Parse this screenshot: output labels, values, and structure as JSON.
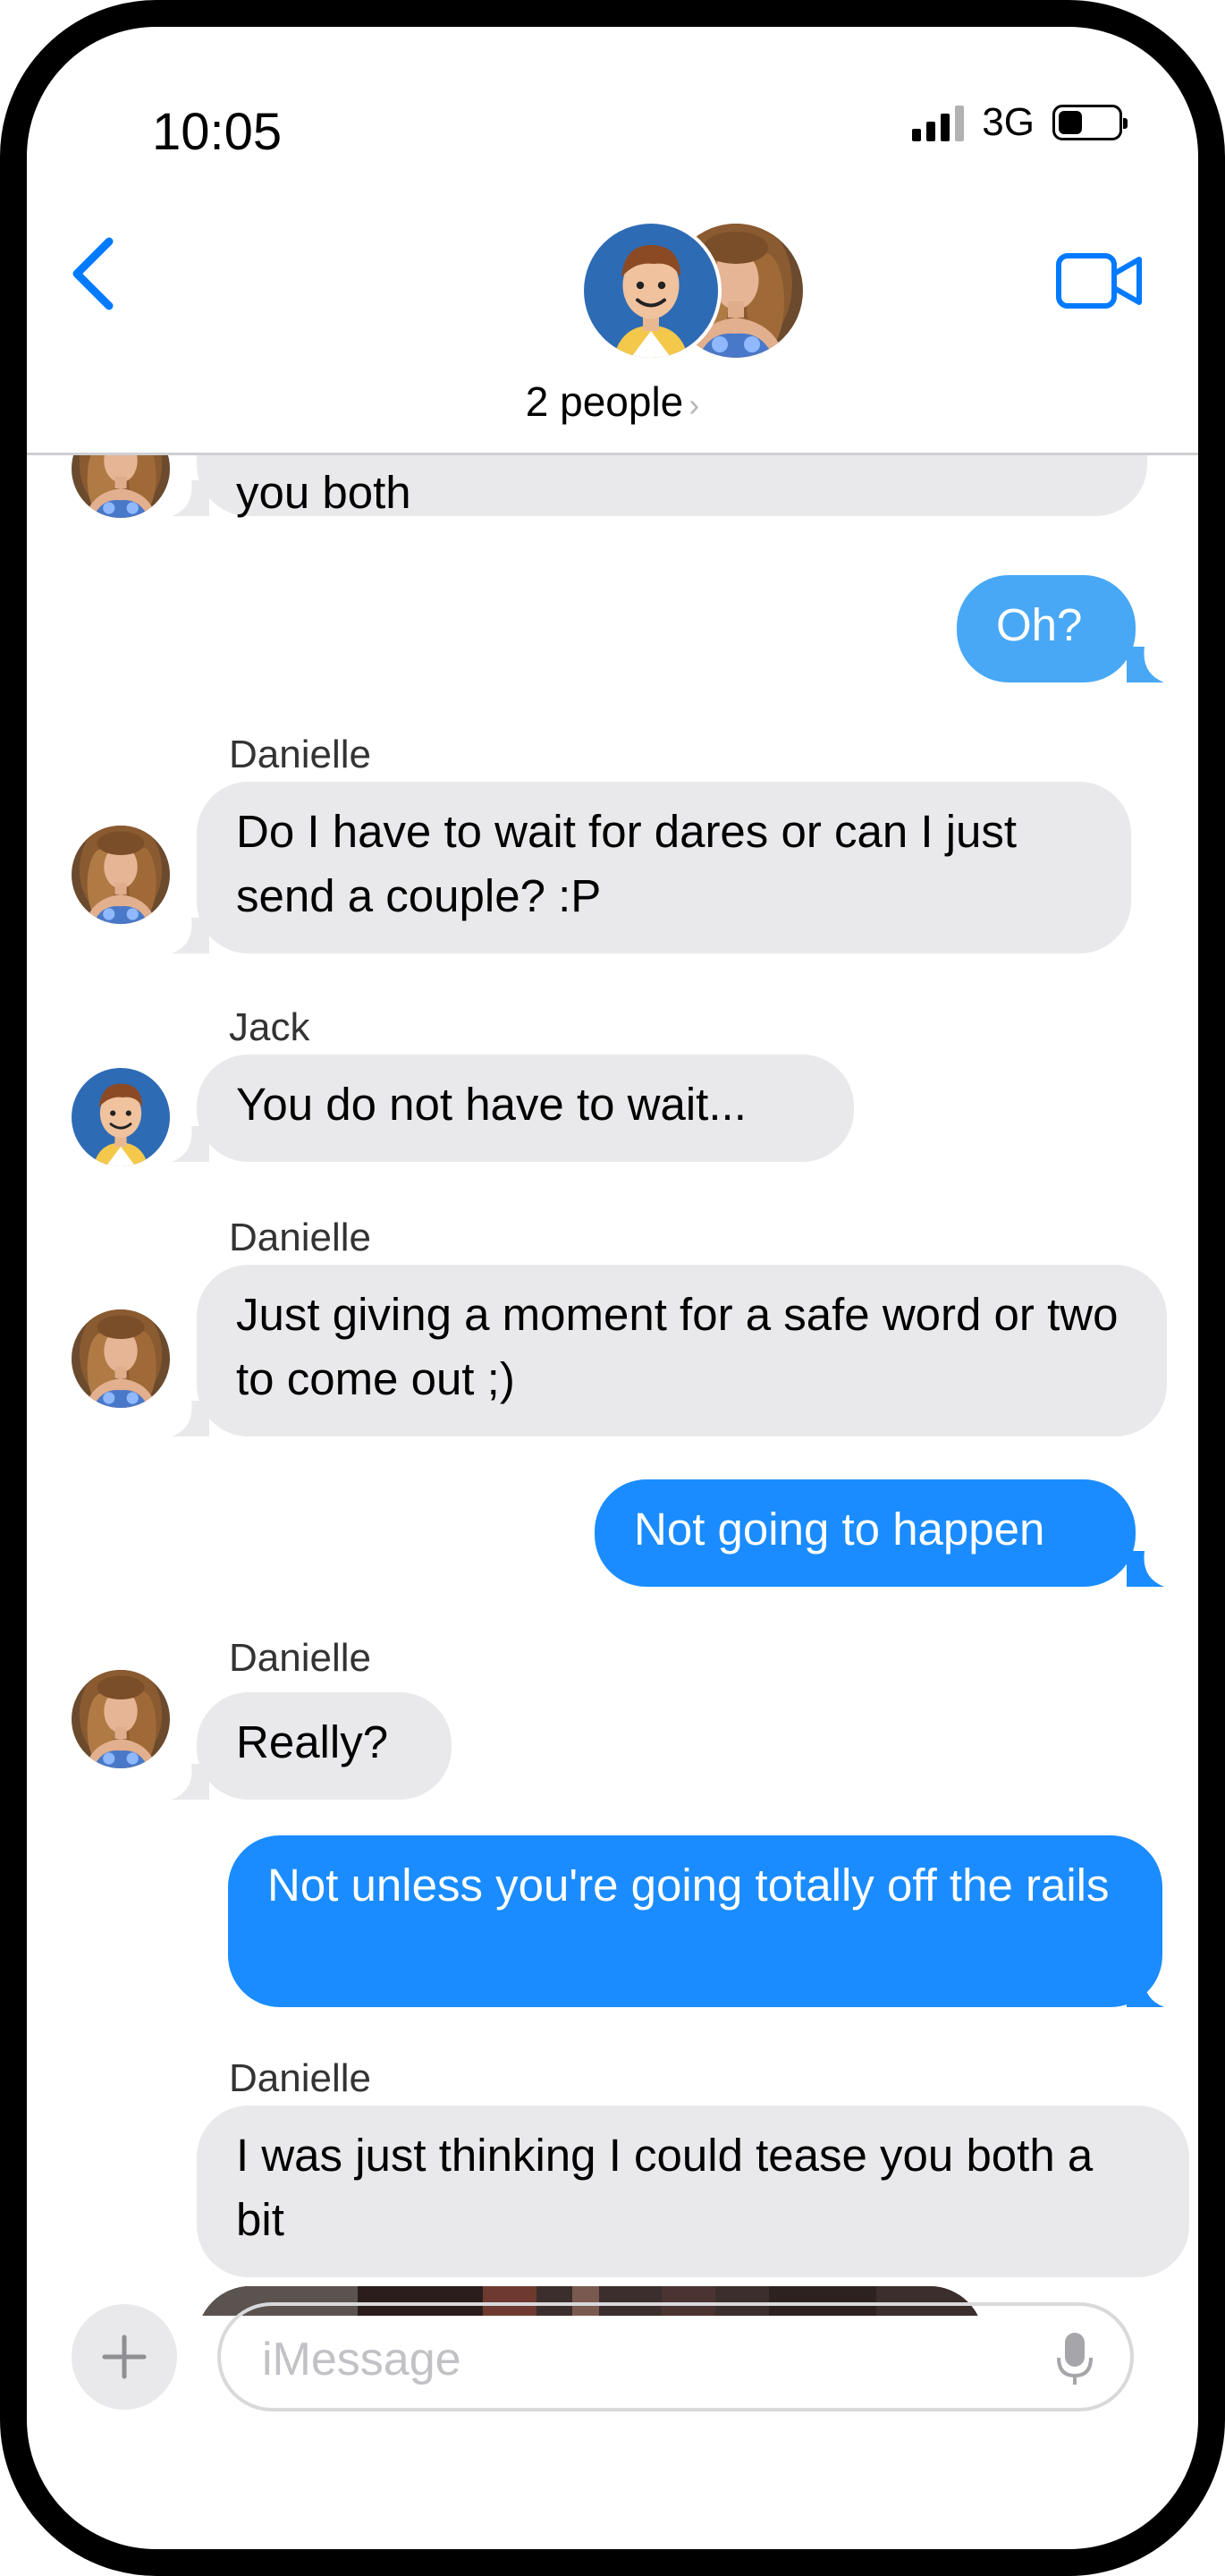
{
  "status_bar": {
    "time": "10:05",
    "network": "3G",
    "battery_level": 0.42
  },
  "header": {
    "title": "2 people",
    "chevron": "›"
  },
  "colors": {
    "accent": "#007aff",
    "outgoing_bubble": "#1a8cff",
    "incoming_bubble": "#e9e9eb"
  },
  "messages": [
    {
      "direction": "in",
      "sender": "",
      "text": "you both"
    },
    {
      "direction": "out",
      "text": "Oh?"
    },
    {
      "direction": "in",
      "sender": "Danielle",
      "text": "Do I have to wait for dares or can I just send a couple? :P"
    },
    {
      "direction": "in",
      "sender": "Jack",
      "text": "You do not have to wait..."
    },
    {
      "direction": "in",
      "sender": "Danielle",
      "text": "Just giving a moment for a safe word or two to come out ;)"
    },
    {
      "direction": "out",
      "text": "Not going to happen"
    },
    {
      "direction": "in",
      "sender": "Danielle",
      "text": "Really?"
    },
    {
      "direction": "out",
      "text": "Not unless you're going totally off the rails"
    },
    {
      "direction": "in",
      "sender": "Danielle",
      "text": "I was just thinking I could tease you both a bit"
    }
  ],
  "compose": {
    "placeholder": "iMessage",
    "value": ""
  },
  "icons": {
    "back": "chevron-left-icon",
    "video": "video-camera-icon",
    "plus": "plus-icon",
    "mic": "microphone-icon"
  }
}
